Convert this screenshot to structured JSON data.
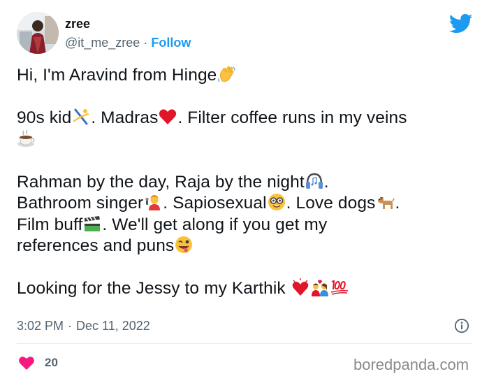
{
  "author": {
    "name": "zree",
    "handle": "@it_me_zree",
    "separator": "·",
    "follow_label": "Follow",
    "avatar_icon": "profile-photo"
  },
  "header_icon": "twitter-bird-icon",
  "tweet": {
    "line1": "Hi, I'm Aravind from Hinge",
    "line2_a": "90s kid",
    "line2_b": ". Madras",
    "line2_c": ". Filter coffee runs in my veins",
    "line4": "Rahman by the day, Raja by the night",
    "line4_end": ".",
    "line5_a": "Bathroom singer",
    "line5_b": ". Sapiosexual",
    "line5_c": ". Love dogs",
    "line5_d": ".",
    "line6_a": "Film buff",
    "line6_b": ". We'll get along if you get my",
    "line7": "references and puns",
    "line9": "Looking for the Jessy to my Karthik ",
    "emojis": [
      "waving-hand",
      "person-cartwheeling",
      "red-heart",
      "hot-beverage",
      "headphone",
      "singer",
      "nerd-face",
      "dog",
      "clapper-board",
      "winking-face-tongue",
      "heart-exclamation",
      "couple-with-heart",
      "hundred-points"
    ]
  },
  "meta": {
    "time": "3:02 PM",
    "separator": "·",
    "date": "Dec 11, 2022"
  },
  "engagement": {
    "likes": "20"
  },
  "watermark": "boredpanda.com",
  "colors": {
    "accent": "#1d9bf0",
    "like": "#f91880",
    "text": "#0f1419",
    "muted": "#536471"
  }
}
